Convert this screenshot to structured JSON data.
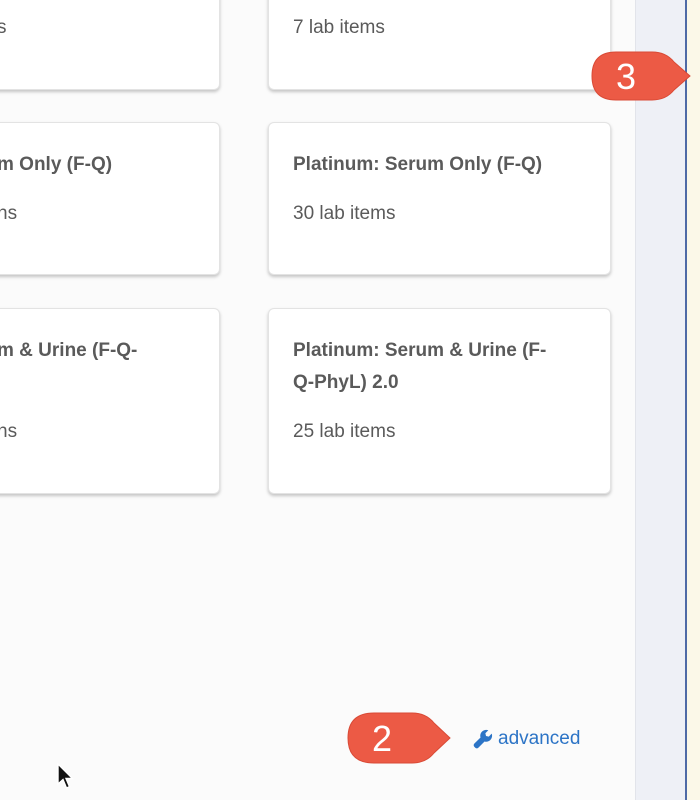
{
  "cards": [
    {
      "title": "",
      "count": "s"
    },
    {
      "title": "",
      "count": "7 lab items"
    },
    {
      "title": "m Only (F-Q)",
      "count": "ns"
    },
    {
      "title": "Platinum: Serum Only (F-Q)",
      "count": "30 lab items"
    },
    {
      "title_line1": "m & Urine (F-Q-",
      "title_line2": "",
      "count": "ns"
    },
    {
      "title_line1": "Platinum: Serum & Urine (F-",
      "title_line2": "Q-PhyL) 2.0",
      "count": "25 lab items"
    }
  ],
  "advanced_link": {
    "label": "advanced",
    "icon": "wrench-icon"
  },
  "callouts": [
    {
      "number": "3",
      "color": "#ec5a45"
    },
    {
      "number": "2",
      "color": "#ec5a45"
    }
  ],
  "colors": {
    "link": "#2c74c6",
    "card_text": "#5a5a5a",
    "callout": "#ec5a45"
  }
}
